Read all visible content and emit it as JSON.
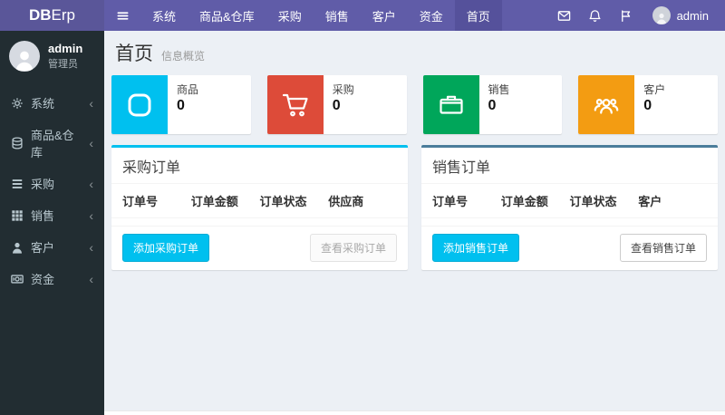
{
  "topbar": {
    "brand": {
      "bold": "DB",
      "light": "Erp"
    },
    "nav": [
      {
        "label": "系统",
        "active": false
      },
      {
        "label": "商品&仓库",
        "active": false
      },
      {
        "label": "采购",
        "active": false
      },
      {
        "label": "销售",
        "active": false
      },
      {
        "label": "客户",
        "active": false
      },
      {
        "label": "资金",
        "active": false
      },
      {
        "label": "首页",
        "active": true
      }
    ],
    "icons": [
      "envelope-icon",
      "bell-icon",
      "flag-icon"
    ],
    "user": "admin"
  },
  "sidebar": {
    "user": {
      "name": "admin",
      "role": "管理员"
    },
    "items": [
      {
        "label": "系统",
        "icon": "cogs-icon"
      },
      {
        "label": "商品&仓库",
        "icon": "database-icon"
      },
      {
        "label": "采购",
        "icon": "list-icon"
      },
      {
        "label": "销售",
        "icon": "grid-icon"
      },
      {
        "label": "客户",
        "icon": "user-icon"
      },
      {
        "label": "资金",
        "icon": "money-icon"
      }
    ]
  },
  "content": {
    "title": "首页",
    "subtitle": "信息概览",
    "stats": [
      {
        "label": "商品",
        "value": "0",
        "color": "#00c0ef",
        "icon": "product-icon"
      },
      {
        "label": "采购",
        "value": "0",
        "color": "#dd4b39",
        "icon": "cart-icon"
      },
      {
        "label": "销售",
        "value": "0",
        "color": "#00a65a",
        "icon": "briefcase-icon"
      },
      {
        "label": "客户",
        "value": "0",
        "color": "#f39c12",
        "icon": "customers-icon"
      }
    ],
    "panels": [
      {
        "title": "采购订单",
        "accent": "#00c0ef",
        "columns": [
          "订单号",
          "订单金额",
          "订单状态",
          "供应商"
        ],
        "add_button": "添加采购订单",
        "view_button": "查看采购订单"
      },
      {
        "title": "销售订单",
        "accent": "#4b7d9b",
        "columns": [
          "订单号",
          "订单金额",
          "订单状态",
          "客户"
        ],
        "add_button": "添加销售订单",
        "view_button": "查看销售订单"
      }
    ]
  },
  "colors": {
    "navbar": "#605ca8",
    "logo_bg": "#5a5699",
    "nav_active": "#55519b",
    "sidebar": "#222d32",
    "content_bg": "#ecf0f5",
    "primary_button": "#00c0ef"
  }
}
